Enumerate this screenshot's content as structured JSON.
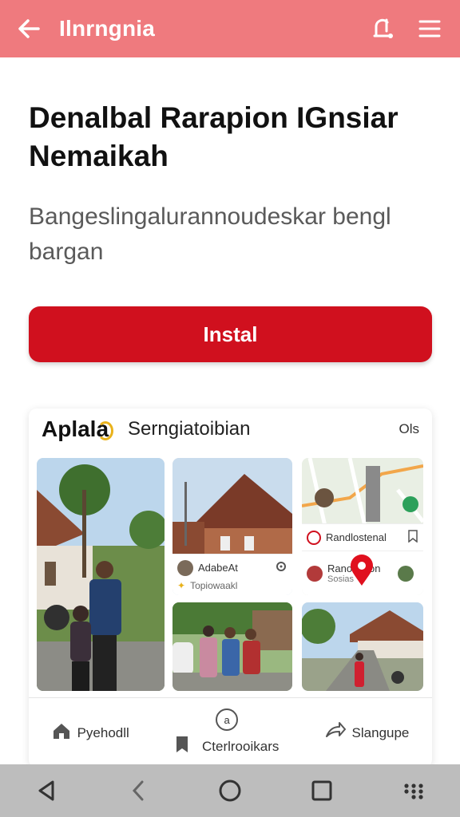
{
  "app_bar": {
    "title": "Ilnrngnia",
    "back_icon": "arrow-left-icon",
    "notification_icon": "bell-alert-icon",
    "menu_icon": "hamburger-menu-icon",
    "background": "#ef7a7e"
  },
  "headline": "Denalbal Rarapion IGnsiar Nemaikah",
  "description": "Bangeslingalurannoudeskar bengl bargan",
  "install_button": {
    "label": "Instal",
    "color": "#d0101e"
  },
  "preview": {
    "brand": "Aplala",
    "subtitle": "Serngiatoibian",
    "right_label": "Ols",
    "tile_2_overlay": {
      "name": "AdabeAt",
      "meta": "Topiowaakl"
    },
    "tile_3_rows": [
      {
        "label": "Randlostenal"
      },
      {
        "label": "Ranobrition",
        "sub": "Sosias"
      }
    ],
    "nav": [
      {
        "label": "Pyehodll",
        "icon": "home-icon"
      },
      {
        "label": "Cterlrooikars",
        "icon": "bookmark-icon",
        "badge": "a"
      },
      {
        "label": "Slangupe",
        "icon": "share-icon"
      }
    ]
  },
  "system_nav": {
    "icons": [
      "back-triangle-icon",
      "chevron-left-icon",
      "home-circle-icon",
      "recents-square-icon",
      "apps-grid-icon"
    ],
    "background": "#bdbdbd"
  }
}
